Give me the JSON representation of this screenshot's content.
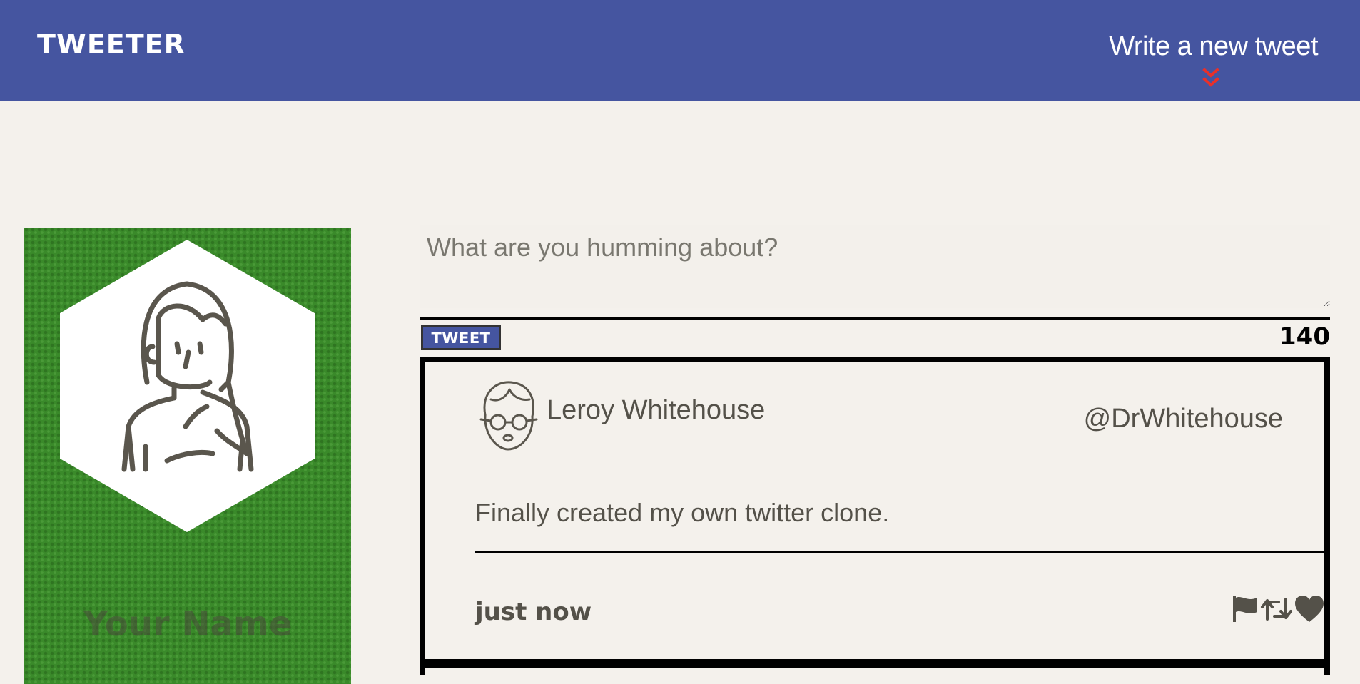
{
  "navbar": {
    "brand": "TWEETER",
    "compose_toggle_label": "Write a new tweet",
    "compose_toggle_icon": "double-chevron-down-icon",
    "background_color": "#4555a0",
    "chevron_color": "#e8302a"
  },
  "profile": {
    "name": "Your Name",
    "avatar_icon": "user-avatar-female-icon",
    "background_color": "#3a8a2a"
  },
  "compose": {
    "placeholder": "What are you humming about?",
    "value": "",
    "submit_label": "TWEET",
    "char_counter": "140"
  },
  "tweets": [
    {
      "author": "Leroy Whitehouse",
      "handle": "@DrWhitehouse",
      "avatar_icon": "user-avatar-glasses-icon",
      "body": "Finally created my own twitter clone.",
      "timestamp": "just now",
      "actions": [
        "flag-icon",
        "retweet-icon",
        "heart-icon"
      ]
    }
  ]
}
